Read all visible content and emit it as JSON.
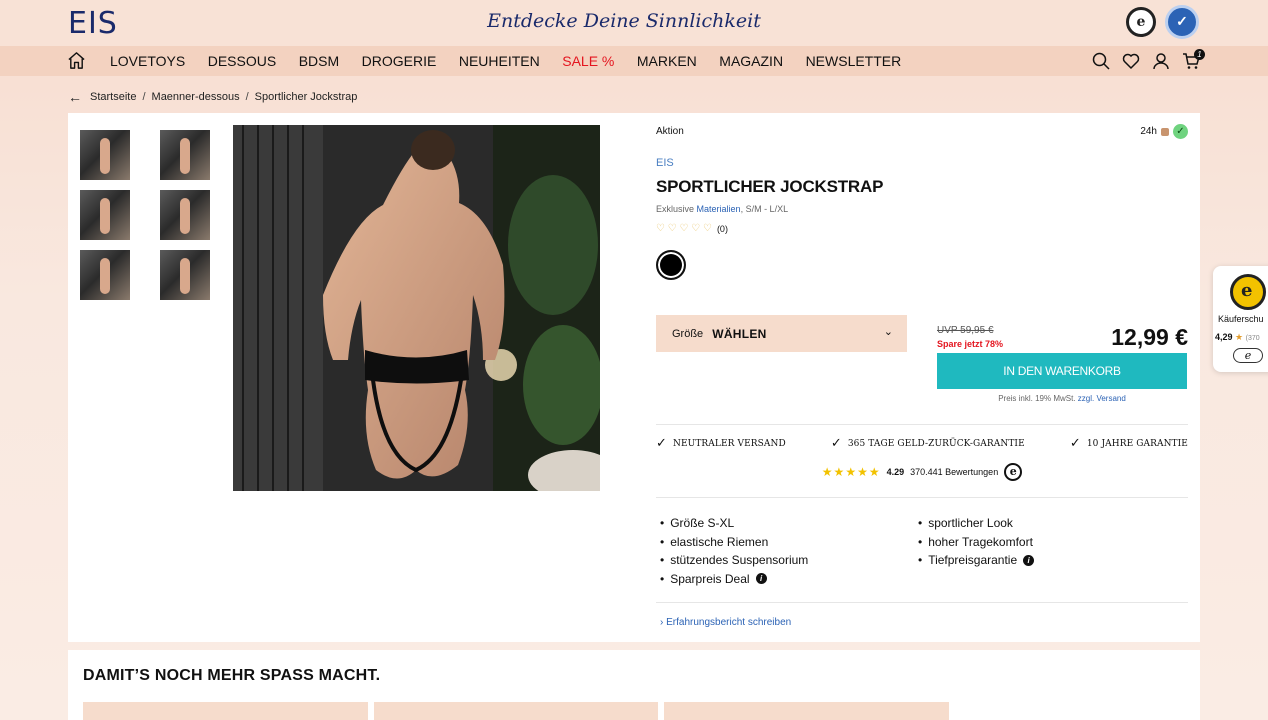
{
  "header": {
    "logo": "EIS",
    "slogan": "Entdecke Deine Sinnlichkeit"
  },
  "nav": {
    "items": [
      "LOVETOYS",
      "DESSOUS",
      "BDSM",
      "DROGERIE",
      "NEUHEITEN",
      "SALE %",
      "MARKEN",
      "MAGAZIN",
      "NEWSLETTER"
    ],
    "cart_count": "1",
    "sale_color": "#e4151f"
  },
  "breadcrumb": {
    "items": [
      "Startseite",
      "Maenner-dessous",
      "Sportlicher Jockstrap"
    ]
  },
  "product": {
    "badge": "Aktion",
    "delivery": "24h",
    "brand": "EIS",
    "title": "SPORTLICHER JOCKSTRAP",
    "subtitle_prefix": "Exklusive",
    "subtitle_link": "Materialien",
    "subtitle_suffix": ", S/M - L/XL",
    "review_count": "(0)",
    "color_selected": "#000000",
    "size_label": "Größe",
    "size_value": "WÄHLEN",
    "uvp": "UVP 59,95 €",
    "save_text": "Spare jetzt 78%",
    "price": "12,99 €",
    "cart_button": "IN DEN WARENKORB",
    "vat_text": "Preis inkl. 19% MwSt.",
    "vat_link": "zzgl. Versand",
    "accent_color": "#1fb9bf"
  },
  "usps": [
    "Neutraler Versand",
    "365 Tage Geld-Zurück-Garantie",
    "10 Jahre Garantie"
  ],
  "shop_rating": {
    "score": "4.29",
    "count": "370.441 Bewertungen"
  },
  "features_left": [
    "Größe S-XL",
    "elastische Riemen",
    "stützendes Suspensorium",
    "Sparpreis Deal"
  ],
  "features_right": [
    "sportlicher Look",
    "hoher Tragekomfort",
    "Tiefpreisgarantie"
  ],
  "review_link": "Erfahrungsbericht schreiben",
  "cross_sell_title": "DAMIT’S NOCH MEHR SPASS MACHT.",
  "trusted_widget": {
    "label": "Käuferschu",
    "score": "4,29",
    "count": "(370"
  }
}
